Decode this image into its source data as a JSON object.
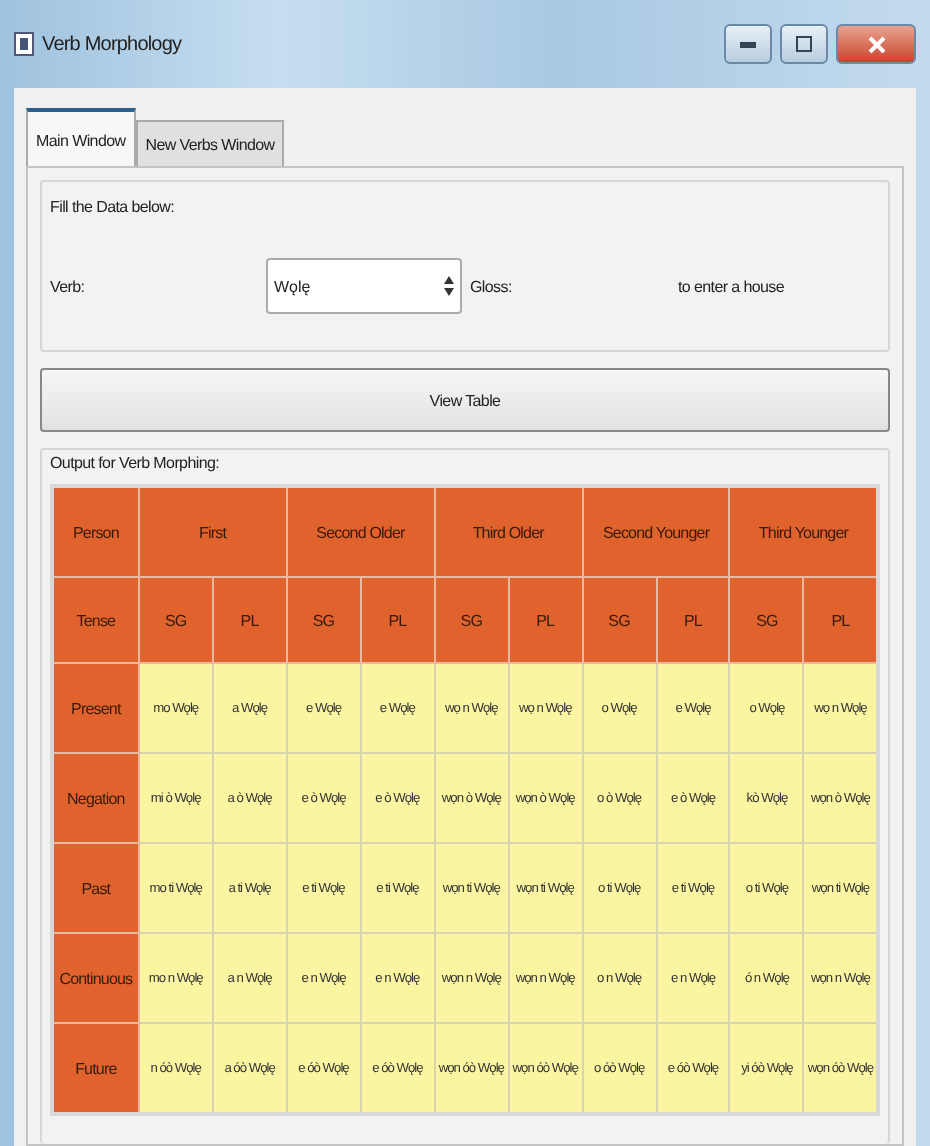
{
  "window": {
    "title": "Verb Morphology"
  },
  "tabs": [
    {
      "label": "Main Window",
      "selected": true
    },
    {
      "label": "New Verbs Window",
      "selected": false
    }
  ],
  "input_group": {
    "title": "Fill the Data below:",
    "verb_label": "Verb:",
    "verb_value": "Wǫlę",
    "gloss_label": "Gloss:",
    "gloss_value": "to enter a house"
  },
  "view_button": "View Table",
  "output_group": {
    "title": "Output for Verb Morphing:",
    "table": {
      "person_label": "Person",
      "tense_label": "Tense",
      "persons": [
        {
          "label": "First",
          "numbers": [
            "SG",
            "PL"
          ]
        },
        {
          "label": "Second Older",
          "numbers": [
            "SG",
            "PL"
          ]
        },
        {
          "label": "Third Older",
          "numbers": [
            "SG",
            "PL"
          ]
        },
        {
          "label": "Second Younger",
          "numbers": [
            "SG",
            "PL"
          ]
        },
        {
          "label": "Third Younger",
          "numbers": [
            "SG",
            "PL"
          ]
        }
      ],
      "rows": [
        {
          "tense": "Present",
          "forms": [
            "mo Wǫlę",
            "a Wǫlę",
            "e Wǫlę",
            "e Wǫlę",
            "wọ n Wǫlę",
            "wọ n Wǫlę",
            "o Wǫlę",
            "e Wǫlę",
            "o Wǫlę",
            "wọ n Wǫlę"
          ]
        },
        {
          "tense": "Negation",
          "forms": [
            "mi ò Wǫlę",
            "a ò Wǫlę",
            "e ò Wǫlę",
            "e ò Wǫlę",
            "wọn ò Wǫlę",
            "wọn ò Wǫlę",
            "o ò Wǫlę",
            "e ò Wǫlę",
            "kò Wǫlę",
            "wọn ò Wǫlę"
          ]
        },
        {
          "tense": "Past",
          "forms": [
            "mo ti Wǫlę",
            "a ti Wǫlę",
            "e ti Wǫlę",
            "e ti Wǫlę",
            "wọn ti Wǫlę",
            "wọn ti Wǫlę",
            "o ti Wǫlę",
            "e ti Wǫlę",
            "o ti Wǫlę",
            "wọn ti Wǫlę"
          ]
        },
        {
          "tense": "Continuous",
          "forms": [
            "mo n Wǫlę",
            "a n Wǫlę",
            "e n Wǫlę",
            "e n Wǫlę",
            "wọn n Wǫlę",
            "wọn n Wǫlę",
            "o n Wǫlę",
            "e n Wǫlę",
            "ó n Wǫlę",
            "wọn n Wǫlę"
          ]
        },
        {
          "tense": "Future",
          "forms": [
            "n óò Wǫlę",
            "a óò Wǫlę",
            "e óò Wǫlę",
            "e óò Wǫlę",
            "wọn óò Wǫlę",
            "wọn óò Wǫlę",
            "o óò Wǫlę",
            "e óò Wǫlę",
            "yi óò Wǫlę",
            "wọn óò Wǫlę"
          ]
        }
      ]
    }
  }
}
